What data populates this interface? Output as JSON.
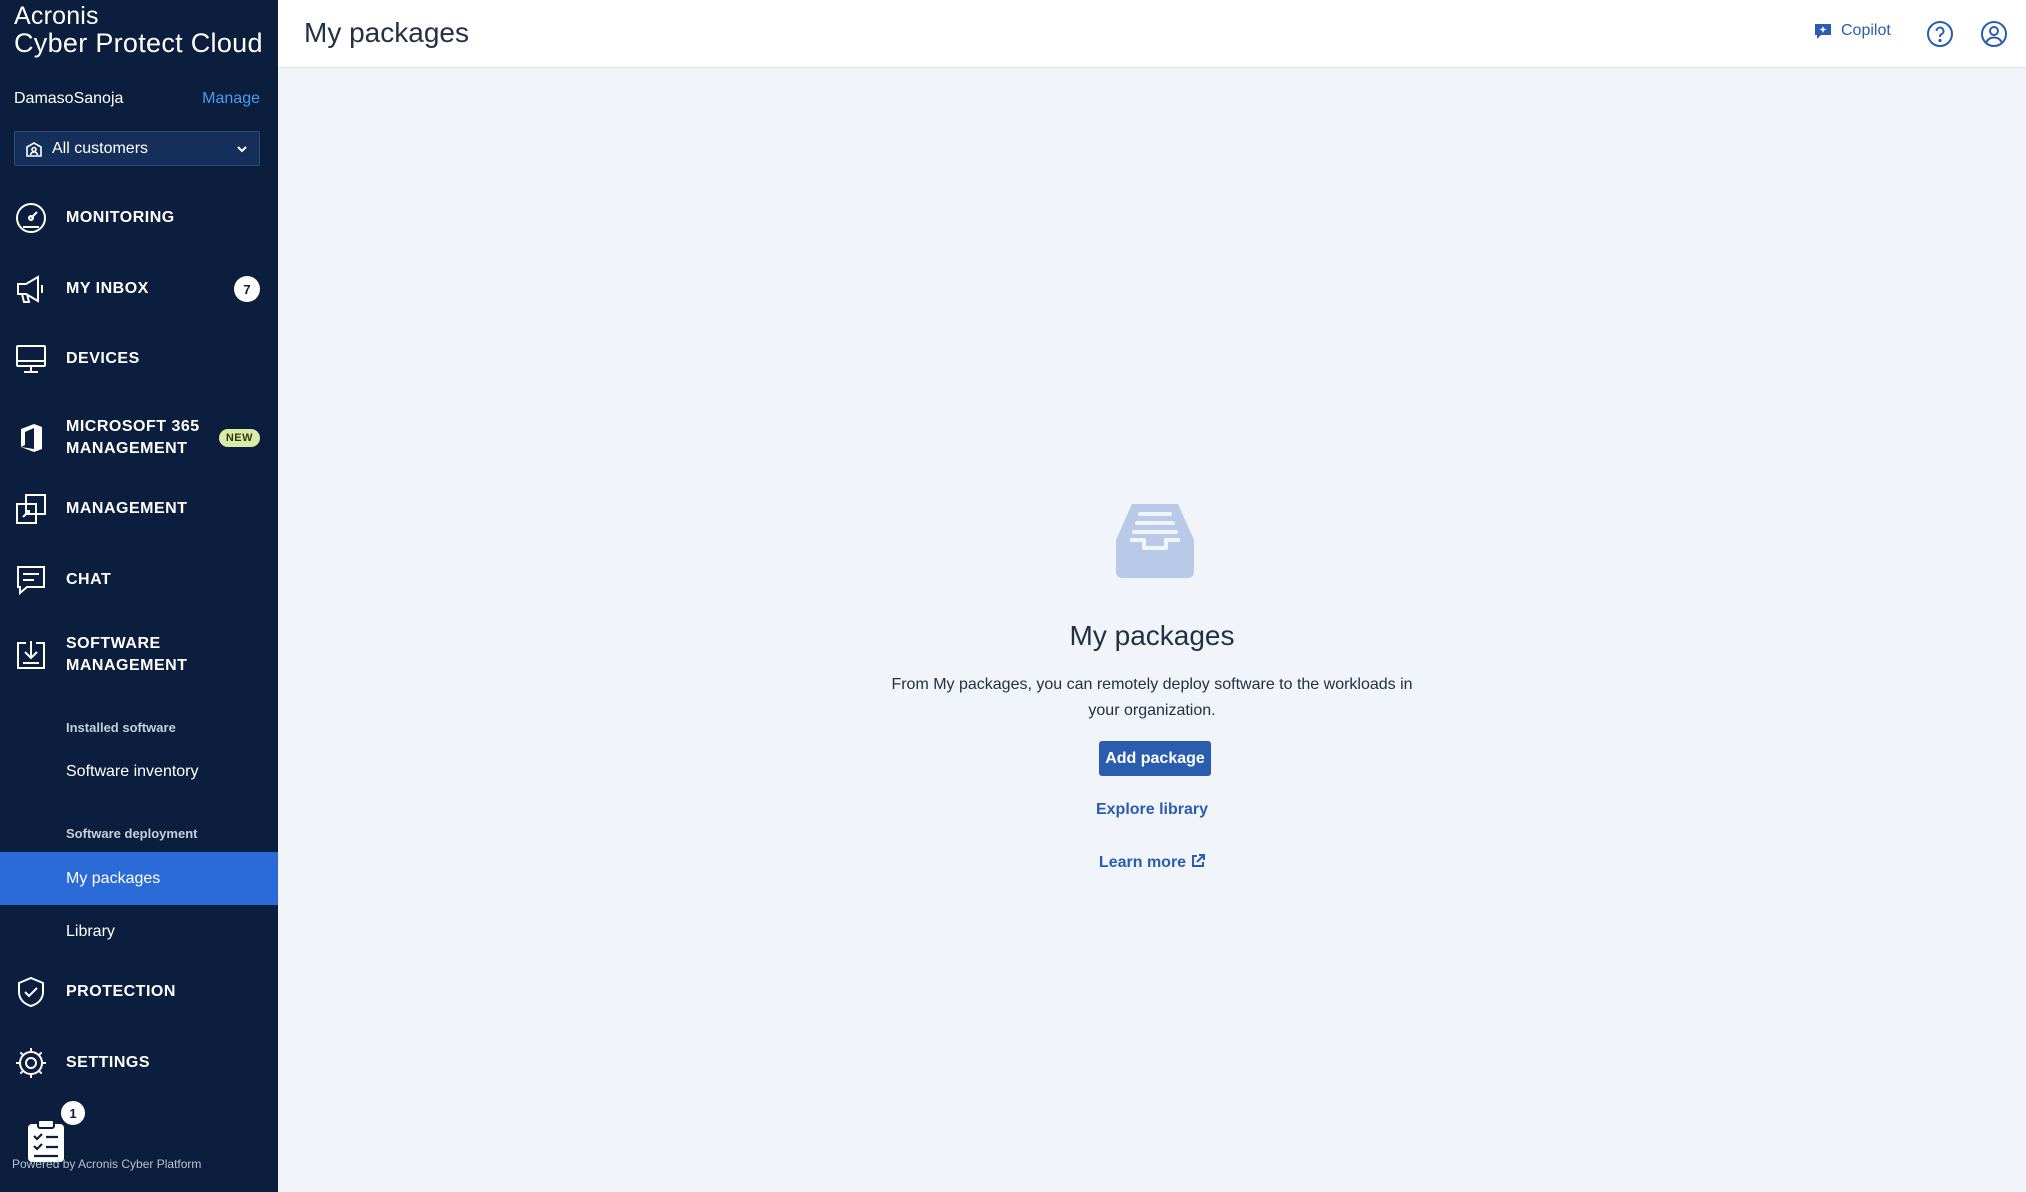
{
  "brand": {
    "line1": "Acronis",
    "line2": "Cyber Protect Cloud"
  },
  "account": {
    "username": "DamasoSanoja",
    "manage_label": "Manage"
  },
  "tenant_selector": {
    "value": "All customers"
  },
  "nav": {
    "monitoring": "MONITORING",
    "inbox": "MY INBOX",
    "inbox_count": "7",
    "devices": "DEVICES",
    "m365_line1": "MICROSOFT 365",
    "m365_line2": "MANAGEMENT",
    "m365_badge": "NEW",
    "management": "MANAGEMENT",
    "chat": "CHAT",
    "software_line1": "SOFTWARE",
    "software_line2": "MANAGEMENT",
    "protection": "PROTECTION",
    "settings": "SETTINGS"
  },
  "software_sub": {
    "group1_heading": "Installed software",
    "software_inventory": "Software inventory",
    "group2_heading": "Software deployment",
    "my_packages": "My packages",
    "library": "Library"
  },
  "tasks": {
    "count": "1"
  },
  "footer": {
    "powered_by": "Powered by Acronis Cyber Platform"
  },
  "header": {
    "title": "My packages",
    "copilot_label": "Copilot"
  },
  "empty_state": {
    "title": "My packages",
    "description": "From My packages, you can remotely deploy software to the workloads in your organization.",
    "add_package_label": "Add package",
    "explore_library_label": "Explore library",
    "learn_more_label": "Learn more"
  },
  "colors": {
    "sidebar_bg": "#0c1e3d",
    "active_item": "#2a6bd8",
    "primary": "#2a5db0",
    "content_bg": "#f1f4f9",
    "empty_icon": "#b9c9e8"
  }
}
